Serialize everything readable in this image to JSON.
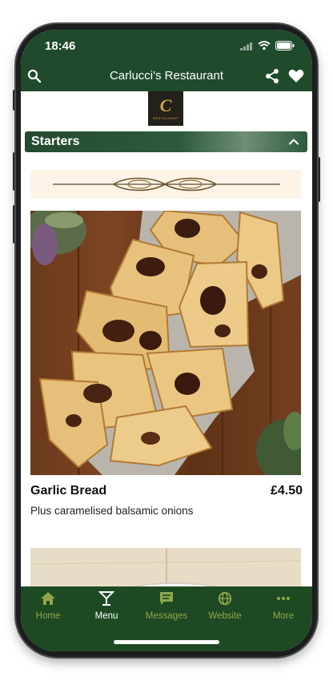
{
  "status_bar": {
    "time": "18:46"
  },
  "header": {
    "title": "Carlucci's Restaurant"
  },
  "logo": {
    "letter": "C",
    "text": "RESTAURANT"
  },
  "section": {
    "title": "Starters"
  },
  "menu_item": {
    "name": "Garlic Bread",
    "price": "£4.50",
    "description": "Plus caramelised balsamic onions"
  },
  "tabs": [
    {
      "label": "Home",
      "icon": "home-icon"
    },
    {
      "label": "Menu",
      "icon": "cocktail-icon"
    },
    {
      "label": "Messages",
      "icon": "message-icon"
    },
    {
      "label": "Website",
      "icon": "globe-icon"
    },
    {
      "label": "More",
      "icon": "more-dots-icon"
    }
  ],
  "colors": {
    "brand_green": "#1f4a2c",
    "tab_inactive": "#8fa64a",
    "accent_gold": "#c9a24a"
  }
}
